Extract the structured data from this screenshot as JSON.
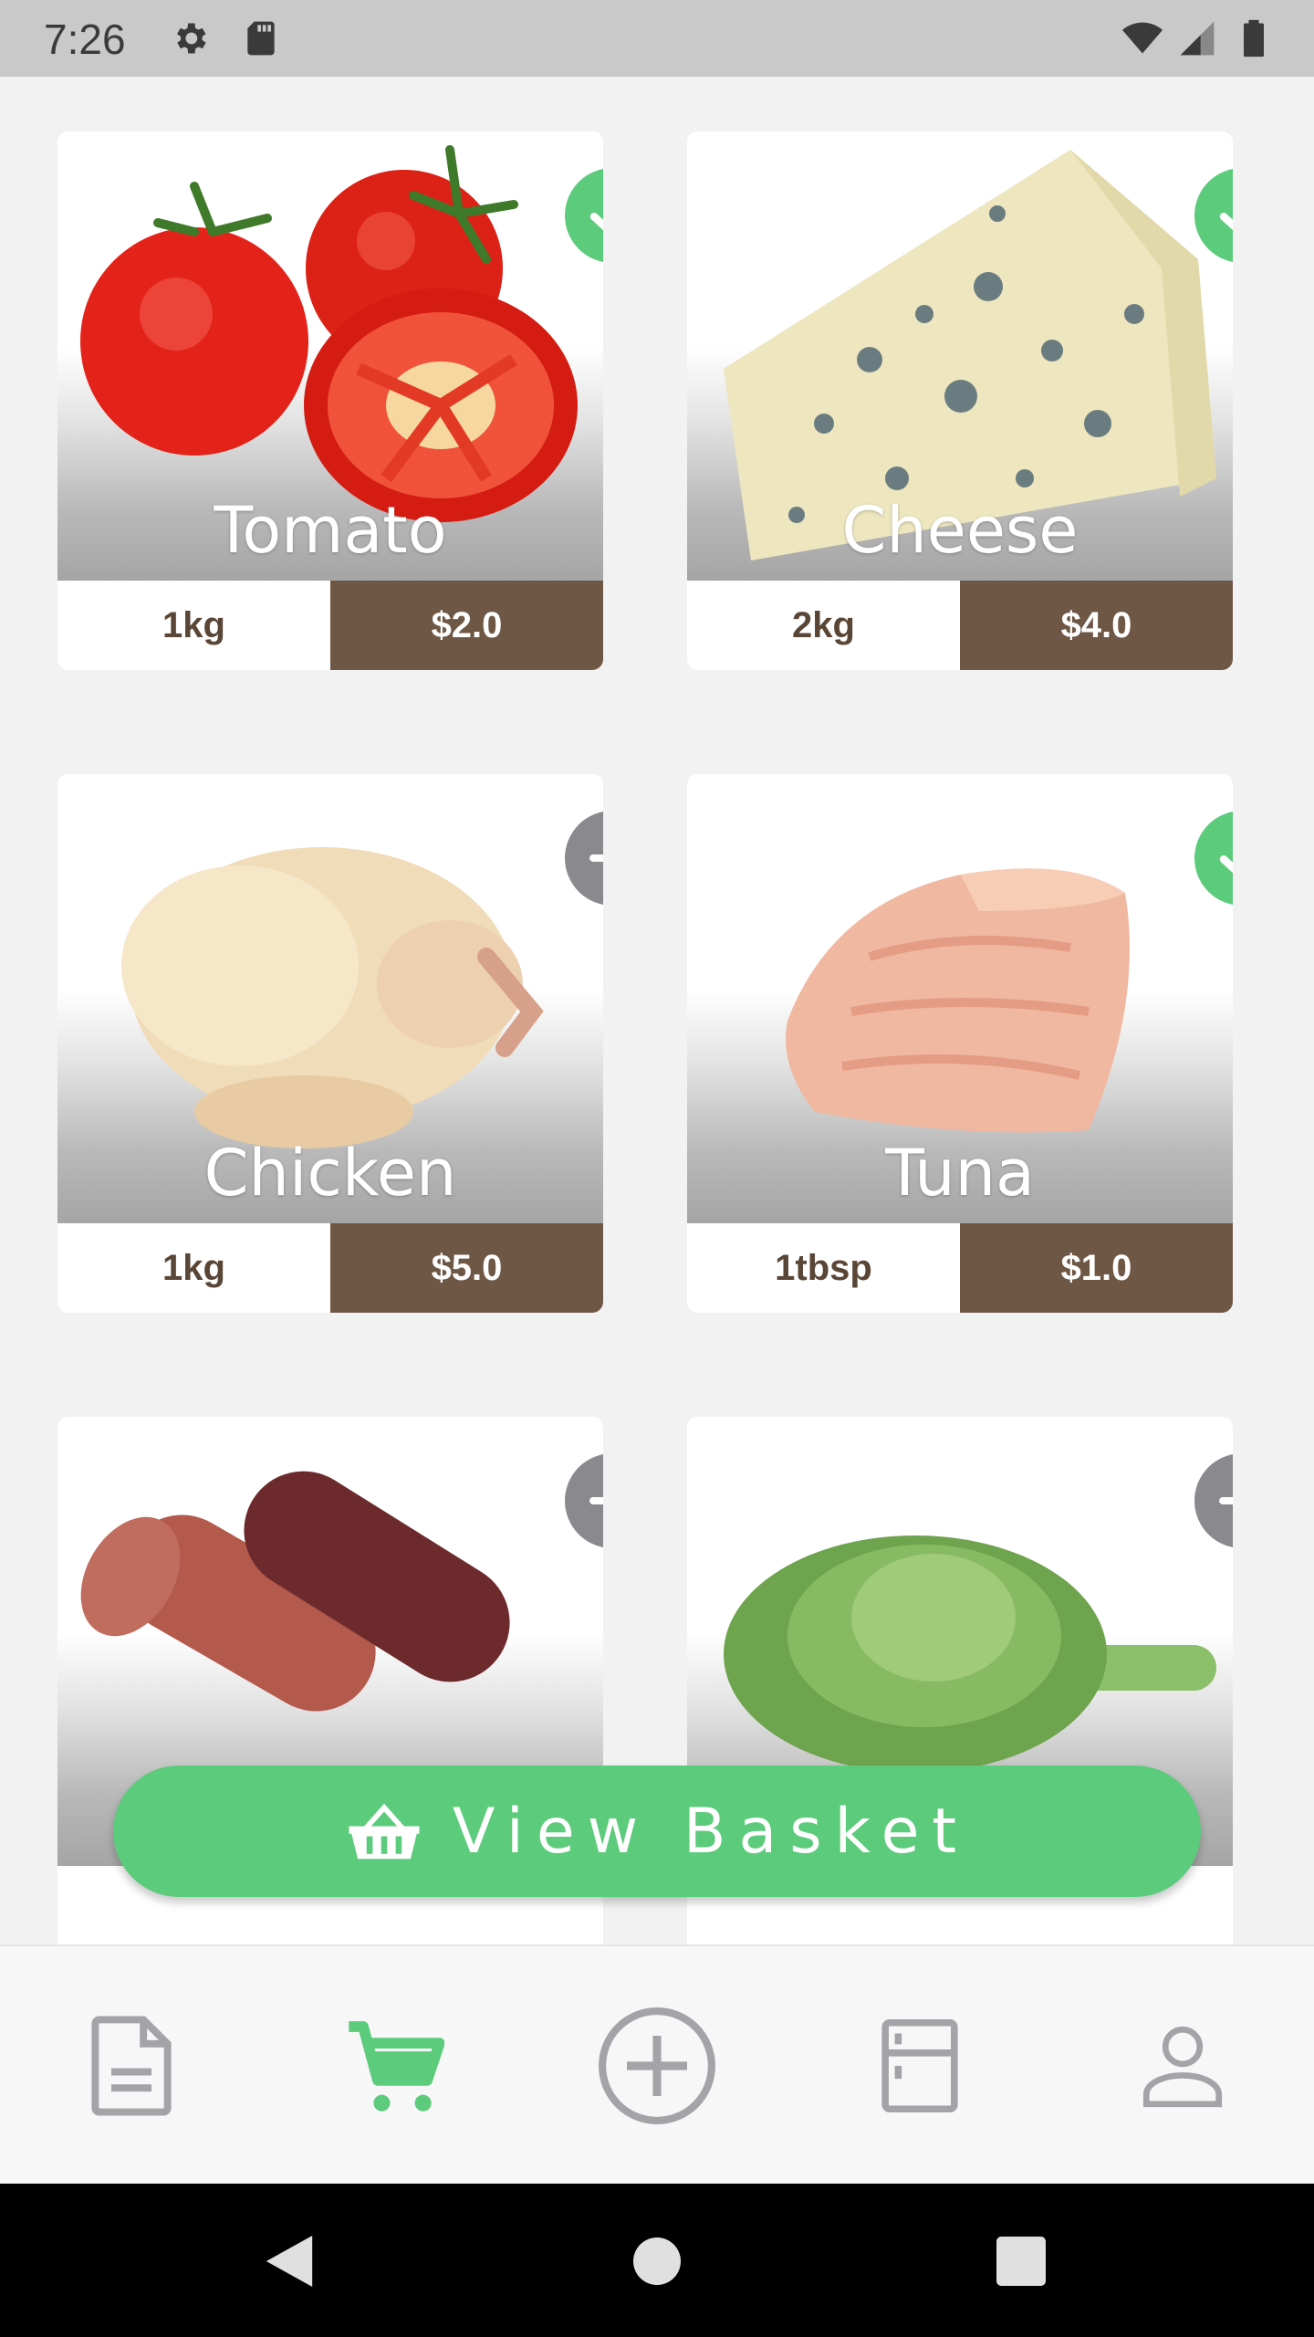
{
  "status_bar": {
    "time": "7:26",
    "icons": [
      "settings-icon",
      "sd-card-icon",
      "wifi-icon",
      "cell-signal-icon",
      "battery-icon"
    ]
  },
  "products": [
    {
      "name": "Tomato",
      "qty": "1kg",
      "price": "$2.0",
      "selected": true,
      "image": "tomato"
    },
    {
      "name": "Cheese",
      "qty": "2kg",
      "price": "$4.0",
      "selected": true,
      "image": "blue-cheese"
    },
    {
      "name": "Chicken",
      "qty": "1kg",
      "price": "$5.0",
      "selected": false,
      "image": "raw-chicken"
    },
    {
      "name": "Tuna",
      "qty": "1tbsp",
      "price": "$1.0",
      "selected": true,
      "image": "tuna"
    },
    {
      "name": "",
      "qty": "",
      "price": "",
      "selected": false,
      "image": "salami"
    },
    {
      "name": "",
      "qty": "",
      "price": "",
      "selected": false,
      "image": "artichoke"
    }
  ],
  "basket_button": {
    "label": "View Basket",
    "icon": "basket-icon"
  },
  "bottom_nav": [
    {
      "icon": "document-icon",
      "active": false
    },
    {
      "icon": "cart-icon",
      "active": true
    },
    {
      "icon": "add-circle-icon",
      "active": false
    },
    {
      "icon": "fridge-icon",
      "active": false
    },
    {
      "icon": "profile-icon",
      "active": false
    }
  ],
  "colors": {
    "accent_green": "#5ccb7c",
    "price_brown": "#6f5746",
    "qty_text": "#5a4636",
    "inactive_icon": "#a3a3a8",
    "add_badge": "#8a8a8e"
  }
}
